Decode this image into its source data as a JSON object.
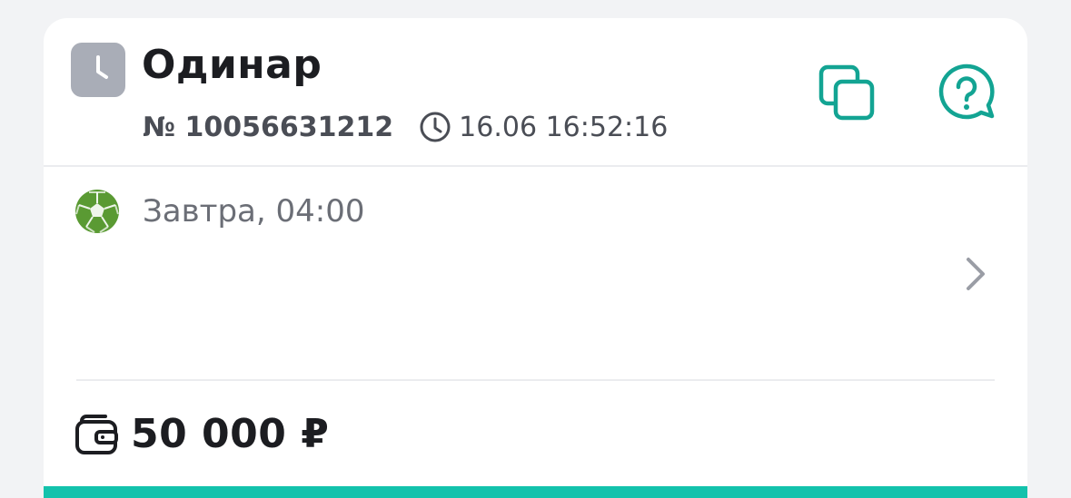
{
  "bet": {
    "title": "Одинар",
    "number": "№ 10056631212",
    "datetime": "16.06 16:52:16"
  },
  "event": {
    "time": "Завтра, 04:00"
  },
  "stake": {
    "amount": "50 000 ₽"
  },
  "icons": {
    "status": "clock-icon",
    "meta_time": "clock-small-icon",
    "copy": "copy-icon",
    "help": "help-chat-icon",
    "sport": "football-ball-icon",
    "chevron": "chevron-right-icon",
    "wallet": "wallet-icon"
  },
  "colors": {
    "accent": "#13a493",
    "accent_bar": "#13c2ac",
    "status_icon_bg": "#a9adb7",
    "football": "#5a9a33"
  }
}
